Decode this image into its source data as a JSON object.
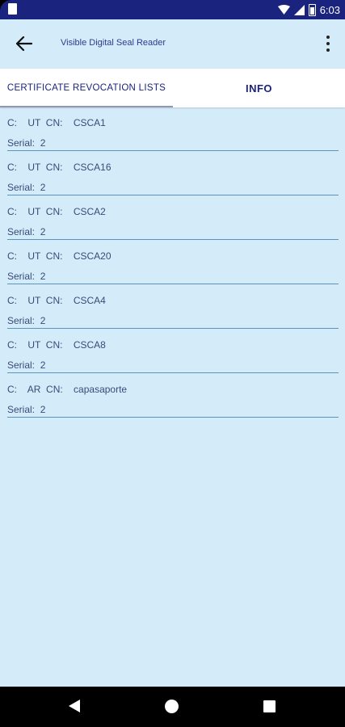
{
  "status": {
    "time": "6:03"
  },
  "toolbar": {
    "title": "Visible Digital Seal Reader"
  },
  "tabs": [
    {
      "label": "CERTIFICATE REVOCATION LISTS"
    },
    {
      "label": "INFO"
    }
  ],
  "crl_list": [
    {
      "c": "UT",
      "cn": "CSCA1",
      "serial": "2"
    },
    {
      "c": "UT",
      "cn": "CSCA16",
      "serial": "2"
    },
    {
      "c": "UT",
      "cn": "CSCA2",
      "serial": "2"
    },
    {
      "c": "UT",
      "cn": "CSCA20",
      "serial": "2"
    },
    {
      "c": "UT",
      "cn": "CSCA4",
      "serial": "2"
    },
    {
      "c": "UT",
      "cn": "CSCA8",
      "serial": "2"
    },
    {
      "c": "AR",
      "cn": "capasaporte",
      "serial": "2"
    }
  ],
  "labels": {
    "c": "C:",
    "cn": "CN:",
    "serial": "Serial:"
  }
}
